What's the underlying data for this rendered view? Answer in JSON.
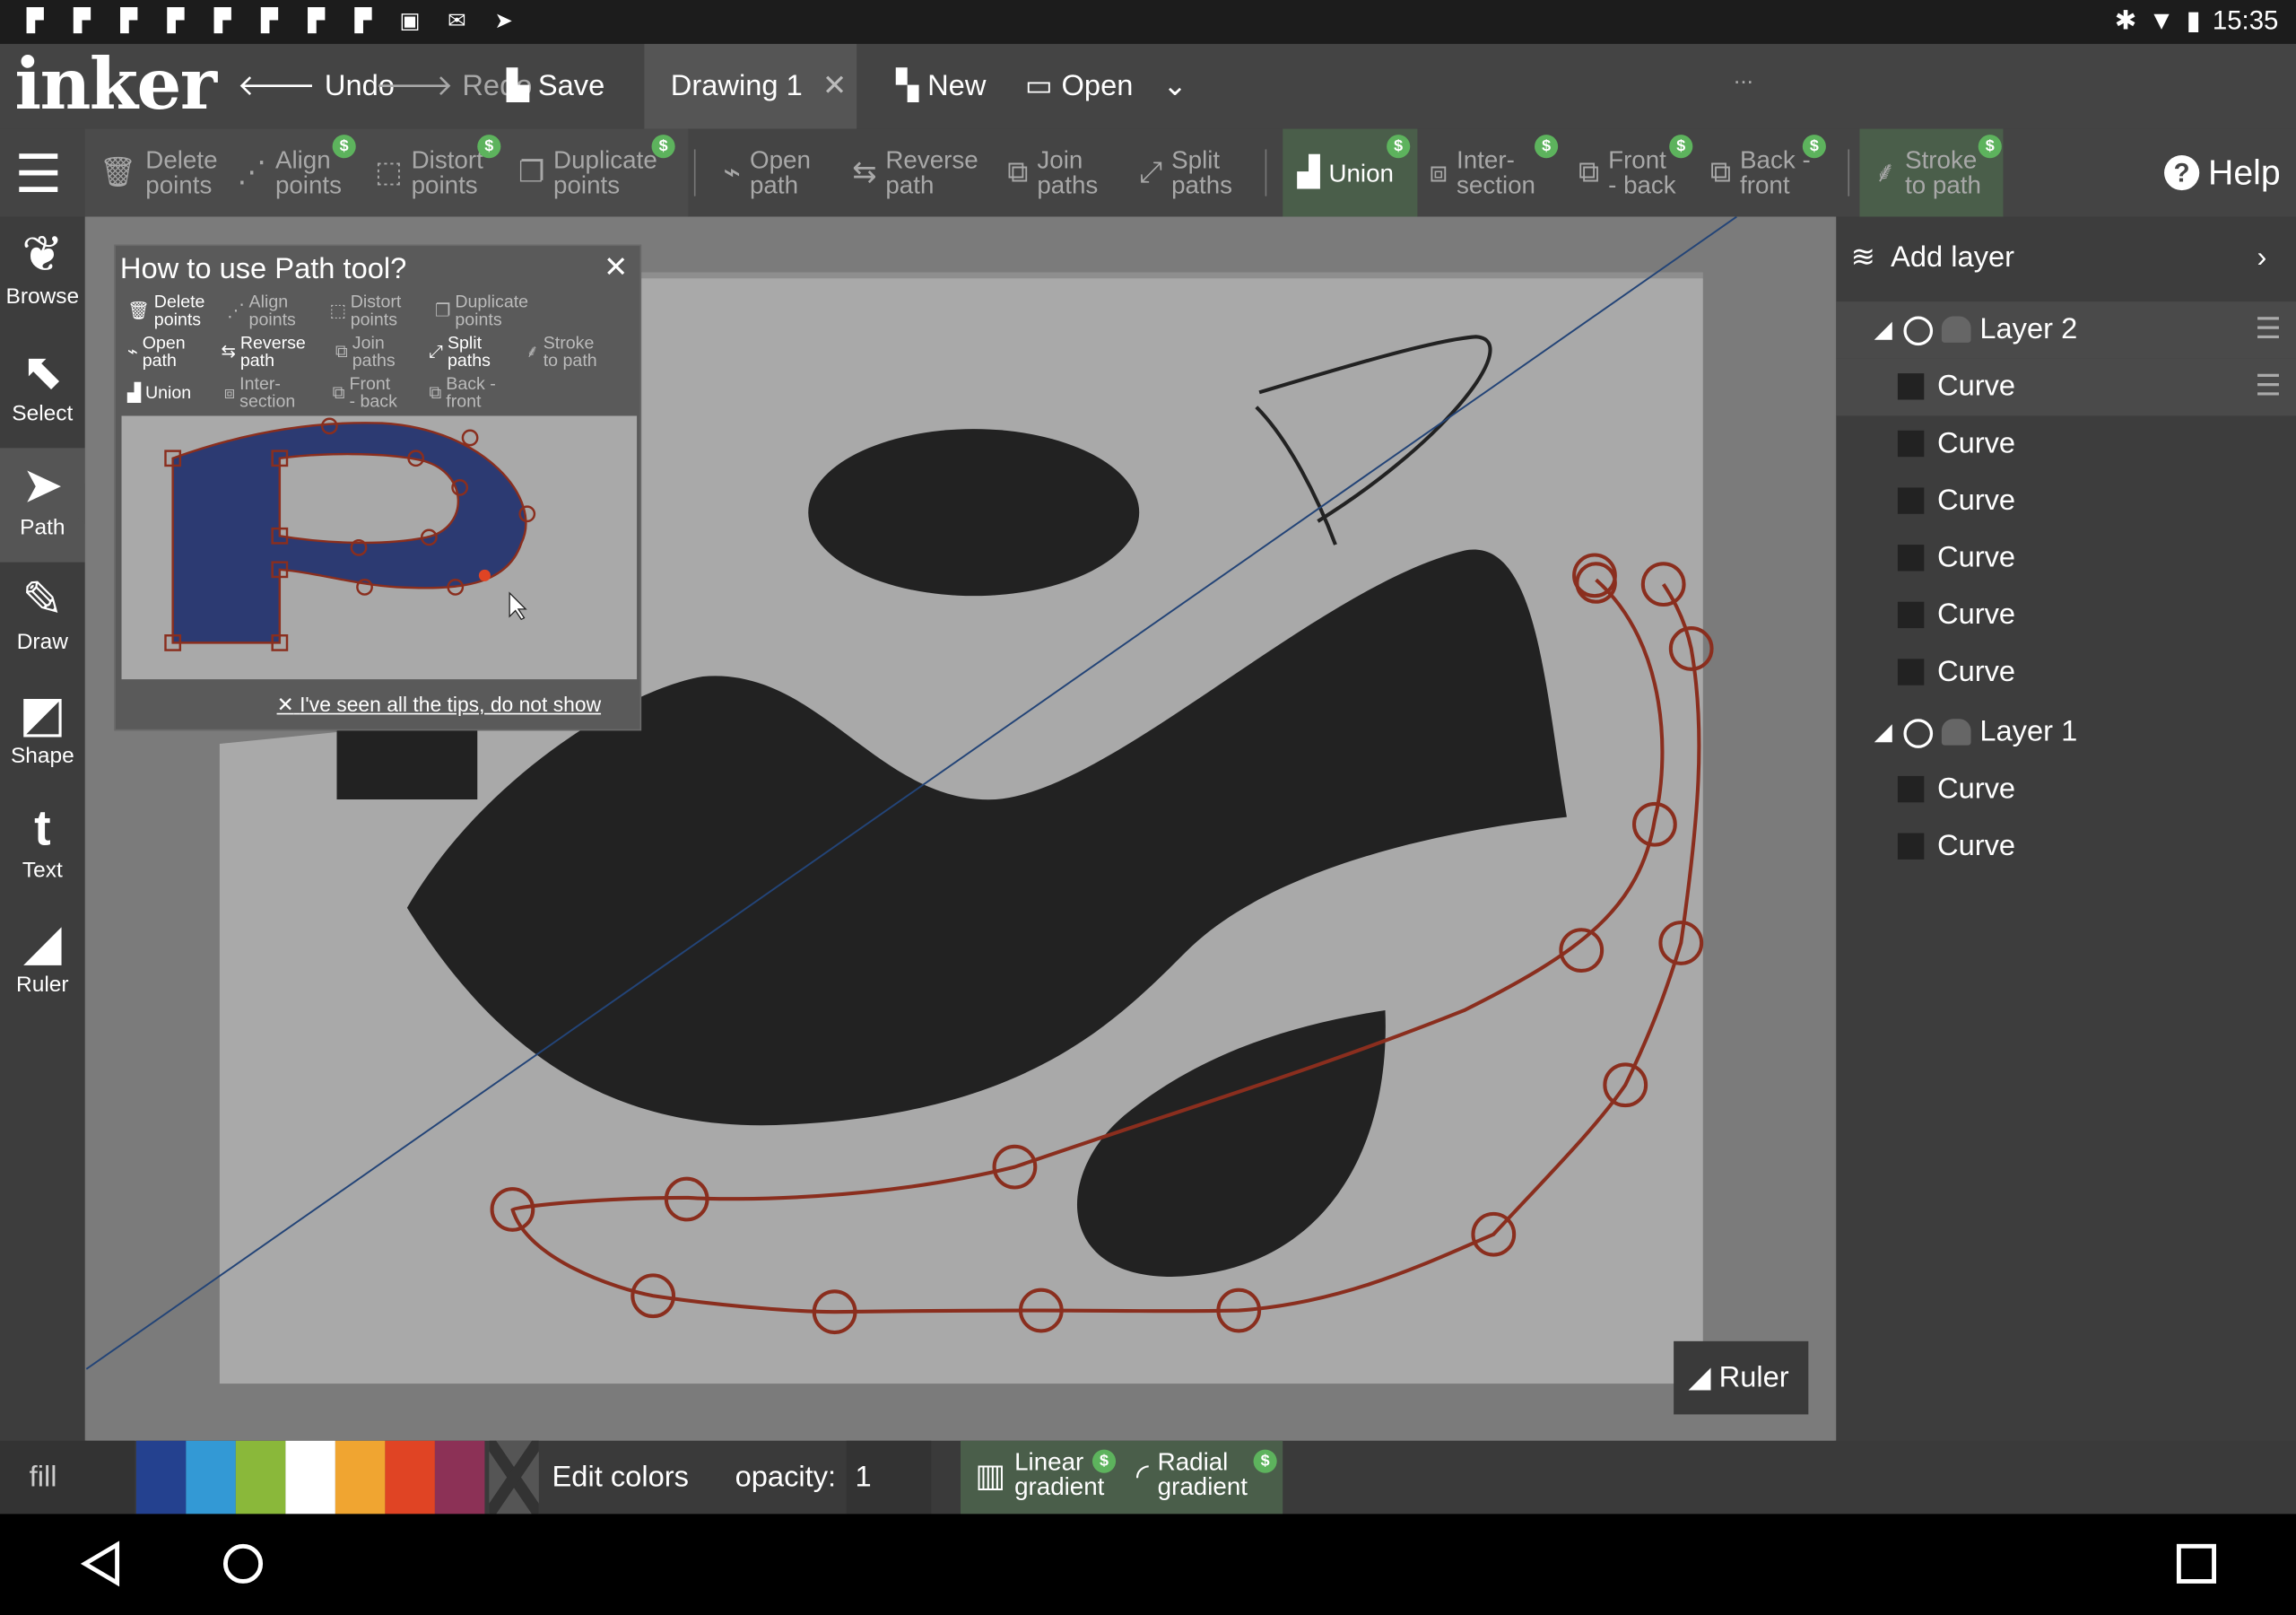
{
  "status_bar": {
    "time": "15:35",
    "notification_icons": [
      "flipboard-icon",
      "flipboard-icon",
      "flipboard-icon",
      "flipboard-icon",
      "flipboard-icon",
      "flipboard-icon",
      "flipboard-icon",
      "flipboard-icon",
      "image-icon",
      "gmail-icon",
      "inbox-icon"
    ]
  },
  "topbar": {
    "app_name": "inker",
    "undo": "Undo",
    "redo": "Redo",
    "save": "Save",
    "doc_tab": "Drawing 1",
    "new": "New",
    "open": "Open",
    "more": "..."
  },
  "toolbar": {
    "delete_points": [
      "Delete",
      "points"
    ],
    "align_points": [
      "Align",
      "points"
    ],
    "distort_points": [
      "Distort",
      "points"
    ],
    "duplicate_points": [
      "Duplicate",
      "points"
    ],
    "open_path": [
      "Open",
      "path"
    ],
    "reverse_path": [
      "Reverse",
      "path"
    ],
    "join_paths": [
      "Join",
      "paths"
    ],
    "split_paths": [
      "Split",
      "paths"
    ],
    "union": "Union",
    "intersection": [
      "Inter-",
      "section"
    ],
    "front_back": [
      "Front",
      "- back"
    ],
    "back_front": [
      "Back -",
      "front"
    ],
    "stroke_to_path": [
      "Stroke",
      "to path"
    ],
    "help": "Help",
    "premium_badge": "$"
  },
  "leftbar": {
    "items": [
      "Browse",
      "Select",
      "Path",
      "Draw",
      "Shape",
      "Text",
      "Ruler"
    ],
    "selected": "Path"
  },
  "tip": {
    "title": "How to use Path tool?",
    "items": {
      "delete_points": [
        "Delete",
        "points"
      ],
      "align_points": [
        "Align",
        "points"
      ],
      "distort_points": [
        "Distort",
        "points"
      ],
      "duplicate_points": [
        "Duplicate",
        "points"
      ],
      "open_path": [
        "Open",
        "path"
      ],
      "reverse_path": [
        "Reverse",
        "path"
      ],
      "join_paths": [
        "Join",
        "paths"
      ],
      "split_paths": [
        "Split",
        "paths"
      ],
      "stroke_to_path": [
        "Stroke",
        "to path"
      ],
      "union": "Union",
      "intersection": [
        "Inter-",
        "section"
      ],
      "front_back": [
        "Front",
        "- back"
      ],
      "back_front": [
        "Back -",
        "front"
      ]
    },
    "dismiss": "I've seen all the tips, do not show"
  },
  "canvas": {
    "ruler_button": "Ruler"
  },
  "layers": {
    "add_layer": "Add layer",
    "layer2": {
      "name": "Layer 2",
      "items": [
        "Curve",
        "Curve",
        "Curve",
        "Curve",
        "Curve",
        "Curve"
      ]
    },
    "layer1": {
      "name": "Layer 1",
      "items": [
        "Curve",
        "Curve"
      ]
    }
  },
  "bottombar": {
    "fill_label": "fill",
    "swatches": [
      "#24418f",
      "#3399d5",
      "#8ab83a",
      "#ffffff",
      "#f0a531",
      "#e04424",
      "#8c3156"
    ],
    "edit_colors": "Edit colors",
    "opacity_label": "opacity:",
    "opacity_value": "1",
    "linear_gradient": [
      "Linear",
      "gradient"
    ],
    "radial_gradient": [
      "Radial",
      "gradient"
    ]
  },
  "colors": {
    "union_bg": "#4a5e4a",
    "path_stroke": "#8a2e1e",
    "guide_line": "#234477",
    "shape_fill": "#222222",
    "tip_shape_fill": "#2c3a72"
  }
}
